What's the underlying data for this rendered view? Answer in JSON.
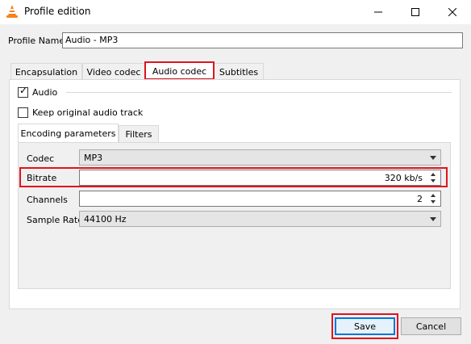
{
  "window": {
    "title": "Profile edition"
  },
  "profile": {
    "label": "Profile Name",
    "value": "Audio - MP3"
  },
  "tabs": [
    {
      "label": "Encapsulation"
    },
    {
      "label": "Video codec"
    },
    {
      "label": "Audio codec"
    },
    {
      "label": "Subtitles"
    }
  ],
  "active_tab": "Audio codec",
  "audio": {
    "enable_label": "Audio",
    "enable_checked": true,
    "keep_original_label": "Keep original audio track",
    "keep_original_checked": false
  },
  "subtabs": [
    {
      "label": "Encoding parameters"
    },
    {
      "label": "Filters"
    }
  ],
  "fields": {
    "codec": {
      "label": "Codec",
      "value": "MP3"
    },
    "bitrate": {
      "label": "Bitrate",
      "value": "320 kb/s"
    },
    "channels": {
      "label": "Channels",
      "value": "2"
    },
    "sample_rate": {
      "label": "Sample Rate",
      "value": "44100 Hz"
    }
  },
  "buttons": {
    "save": "Save",
    "cancel": "Cancel"
  },
  "colors": {
    "highlight": "#e0141e",
    "focus": "#0078d7",
    "vlc_orange": "#f58220"
  }
}
